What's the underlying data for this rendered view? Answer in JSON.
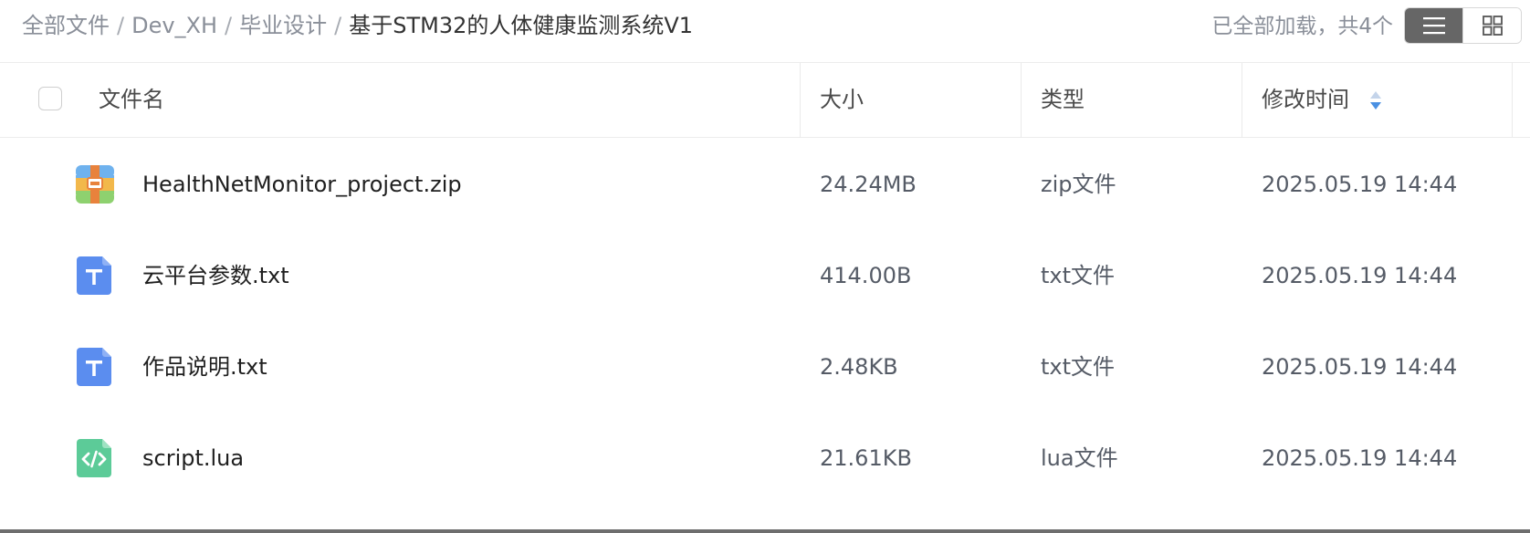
{
  "breadcrumb": {
    "items": [
      "全部文件",
      "Dev_XH",
      "毕业设计"
    ],
    "separator": "/",
    "current": "基于STM32的人体健康监测系统V1"
  },
  "status": {
    "load_text": "已全部加载，共4个"
  },
  "view_toggle": {
    "list_icon": "list-view-icon",
    "grid_icon": "grid-view-icon",
    "active": "list"
  },
  "table": {
    "headers": {
      "name": "文件名",
      "size": "大小",
      "type": "类型",
      "modified": "修改时间"
    },
    "sort_icon": "sort-icon",
    "rows": [
      {
        "name": "HealthNetMonitor_project.zip",
        "size": "24.24MB",
        "type": "zip文件",
        "modified": "2025.05.19 14:44",
        "icon": "zip-file-icon"
      },
      {
        "name": "云平台参数.txt",
        "size": "414.00B",
        "type": "txt文件",
        "modified": "2025.05.19 14:44",
        "icon": "txt-file-icon"
      },
      {
        "name": "作品说明.txt",
        "size": "2.48KB",
        "type": "txt文件",
        "modified": "2025.05.19 14:44",
        "icon": "txt-file-icon"
      },
      {
        "name": "script.lua",
        "size": "21.61KB",
        "type": "lua文件",
        "modified": "2025.05.19 14:44",
        "icon": "code-file-icon"
      }
    ]
  },
  "colors": {
    "accent": "#4a90e2",
    "toggle_active": "#666666",
    "txt_icon": "#5b8def",
    "zip_icon": "#f0b44a",
    "code_icon": "#5ccb98"
  }
}
